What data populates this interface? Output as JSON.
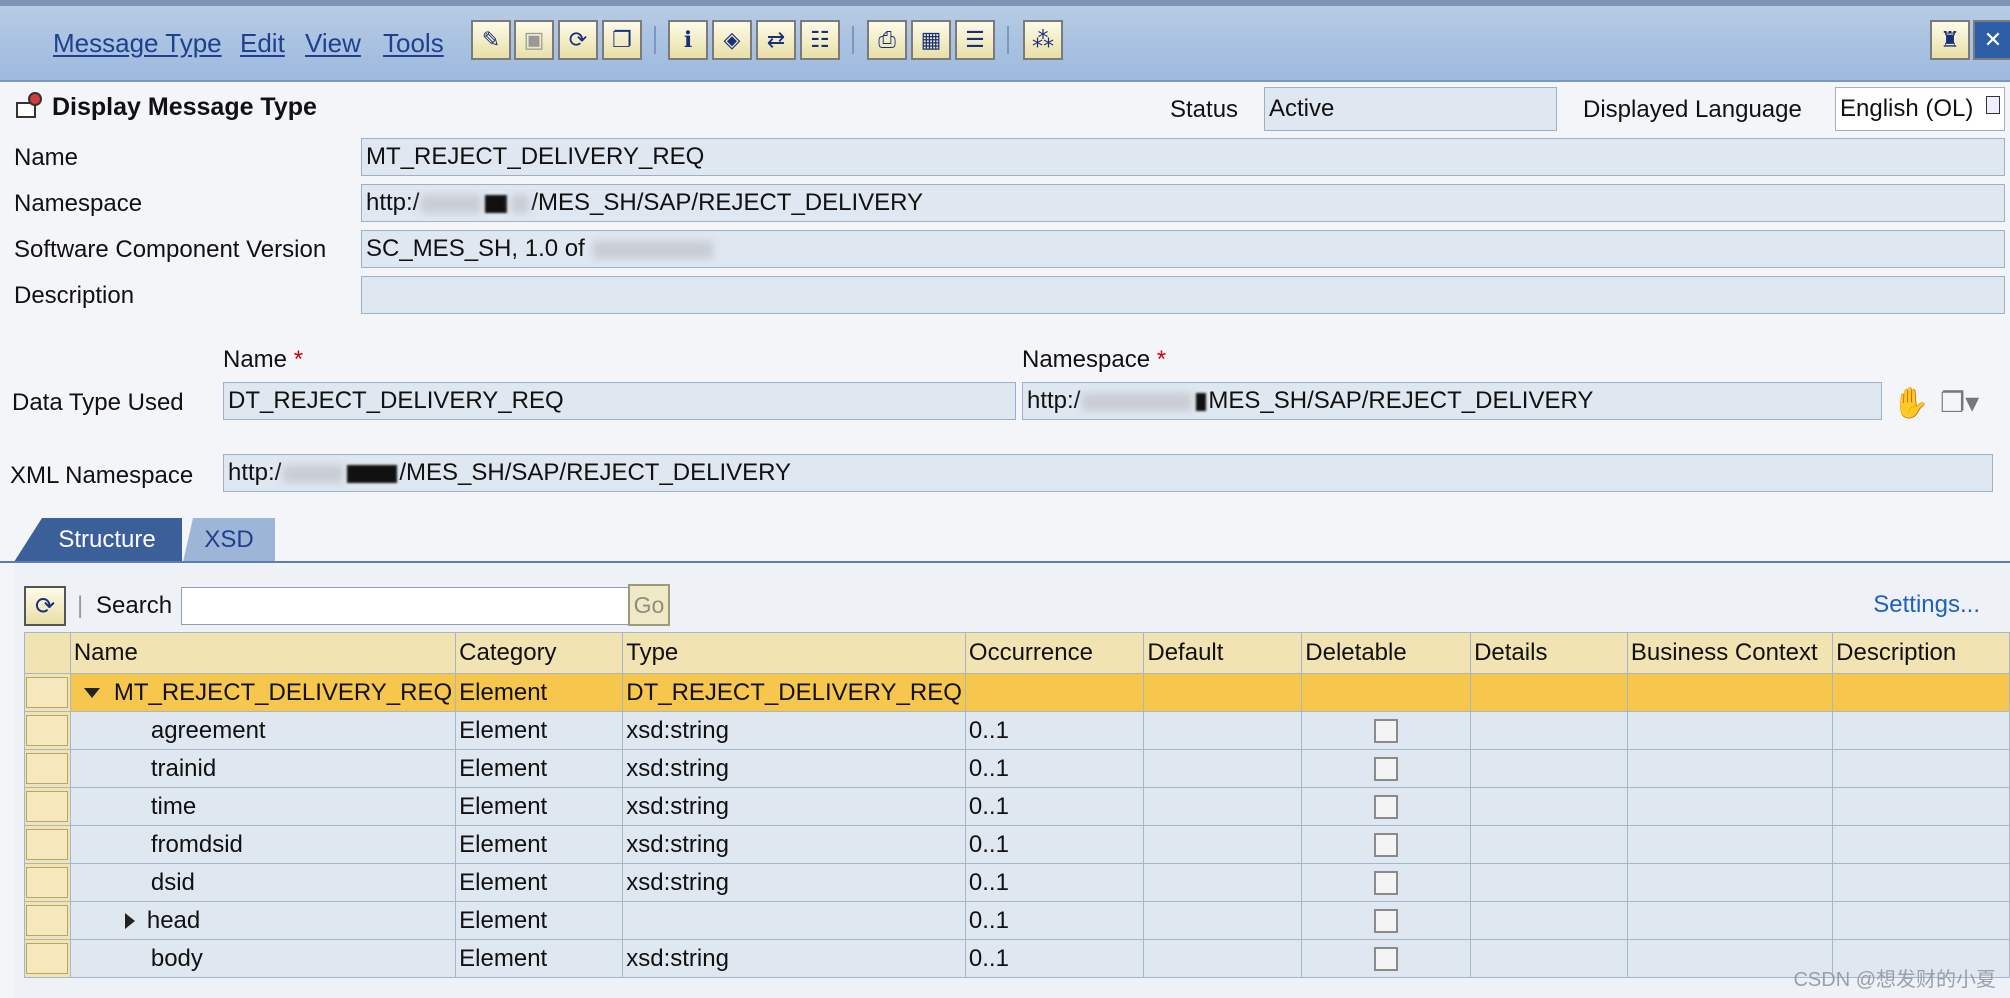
{
  "menu": [
    "Message Type",
    "Edit",
    "View",
    "Tools"
  ],
  "header": {
    "title": "Display Message Type",
    "status_label": "Status",
    "status_value": "Active",
    "language_label": "Displayed Language",
    "language_value": "English (OL)"
  },
  "form": {
    "name_label": "Name",
    "name_value": "MT_REJECT_DELIVERY_REQ",
    "namespace_label": "Namespace",
    "namespace_prefix": "http:/",
    "namespace_suffix": "/MES_SH/SAP/REJECT_DELIVERY",
    "scv_label": "Software Component Version",
    "scv_value": "SC_MES_SH, 1.0 of ",
    "description_label": "Description",
    "description_value": ""
  },
  "datatype": {
    "name_label": "Name",
    "namespace_label": "Namespace",
    "required_mark": "*",
    "used_label": "Data Type Used",
    "name_value": "DT_REJECT_DELIVERY_REQ",
    "namespace_prefix": "http:/",
    "namespace_suffix": "MES_SH/SAP/REJECT_DELIVERY",
    "xml_ns_label": "XML Namespace",
    "xml_ns_prefix": "http:/",
    "xml_ns_suffix": "/MES_SH/SAP/REJECT_DELIVERY"
  },
  "tabs": [
    {
      "label": "Structure",
      "active": true
    },
    {
      "label": "XSD",
      "active": false
    }
  ],
  "table_toolbar": {
    "search_label": "Search",
    "search_value": "",
    "go_label": "Go",
    "settings_label": "Settings..."
  },
  "columns": [
    "Name",
    "Category",
    "Type",
    "Occurrence",
    "Default",
    "Deletable",
    "Details",
    "Business Context",
    "Description"
  ],
  "rows": [
    {
      "name": "MT_REJECT_DELIVERY_REQ",
      "category": "Element",
      "type": "DT_REJECT_DELIVERY_REQ",
      "occurrence": "",
      "checkbox": false
    },
    {
      "name": "agreement",
      "category": "Element",
      "type": "xsd:string",
      "occurrence": "0..1",
      "checkbox": true
    },
    {
      "name": "trainid",
      "category": "Element",
      "type": "xsd:string",
      "occurrence": "0..1",
      "checkbox": true
    },
    {
      "name": "time",
      "category": "Element",
      "type": "xsd:string",
      "occurrence": "0..1",
      "checkbox": true
    },
    {
      "name": "fromdsid",
      "category": "Element",
      "type": "xsd:string",
      "occurrence": "0..1",
      "checkbox": true
    },
    {
      "name": "dsid",
      "category": "Element",
      "type": "xsd:string",
      "occurrence": "0..1",
      "checkbox": true
    },
    {
      "name": "head",
      "category": "Element",
      "type": "",
      "occurrence": "0..1",
      "checkbox": true
    },
    {
      "name": "body",
      "category": "Element",
      "type": "xsd:string",
      "occurrence": "0..1",
      "checkbox": true
    }
  ],
  "watermark": "CSDN @想发财的小夏",
  "colors": {
    "selected_row": "#f7c74d",
    "header_cell": "#f2e3b3",
    "field": "#dfe7f1",
    "tab_active": "#3b5f99"
  }
}
